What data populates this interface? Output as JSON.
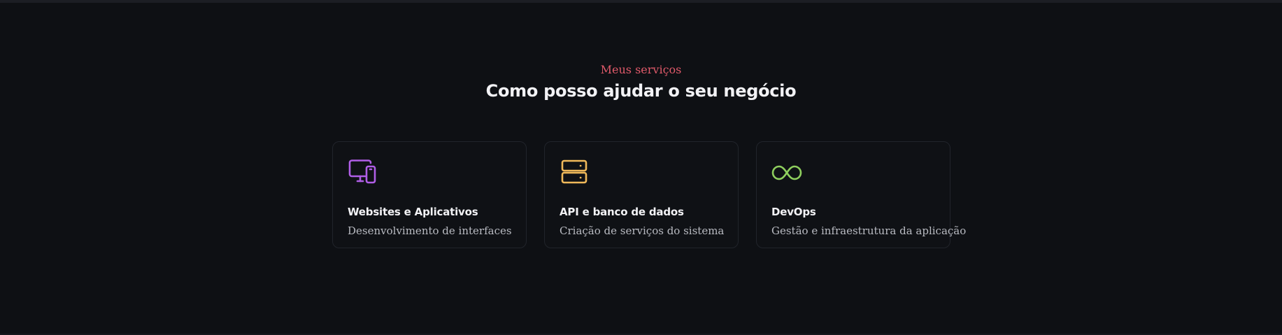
{
  "services": {
    "eyebrow": "Meus serviços",
    "heading": "Como posso ajudar o seu negócio",
    "accent_color": "#e05a6a",
    "items": [
      {
        "title": "Websites e Aplicativos",
        "description": "Desenvolvimento de interfaces",
        "icon": "devices-icon",
        "icon_color": "#b05ee6"
      },
      {
        "title": "API e banco de dados",
        "description": "Criação de serviços do sistema",
        "icon": "server-icon",
        "icon_color": "#f0b95a"
      },
      {
        "title": "DevOps",
        "description": "Gestão e infraestrutura da aplicação",
        "icon": "infinity-icon",
        "icon_color": "#8fcf5e"
      }
    ]
  }
}
